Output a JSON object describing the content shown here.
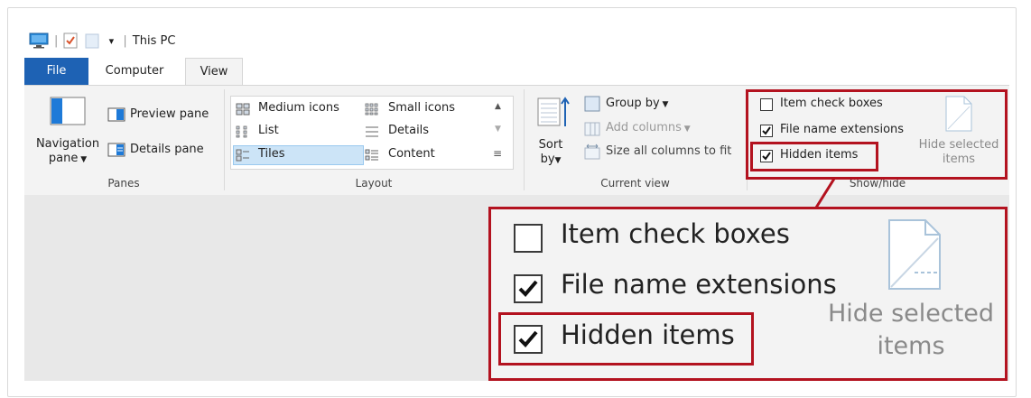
{
  "window": {
    "title": "This PC"
  },
  "tabs": {
    "file": "File",
    "computer": "Computer",
    "view": "View"
  },
  "panes": {
    "group_label": "Panes",
    "navigation_pane_line1": "Navigation",
    "navigation_pane_line2": "pane",
    "preview_pane": "Preview pane",
    "details_pane": "Details pane"
  },
  "layout": {
    "group_label": "Layout",
    "items": [
      "Medium icons",
      "Small icons",
      "List",
      "Details",
      "Tiles",
      "Content"
    ],
    "selected": "Tiles"
  },
  "current_view": {
    "group_label": "Current view",
    "sort_line1": "Sort",
    "sort_line2": "by",
    "group_by": "Group by",
    "add_columns": "Add columns",
    "size_all_columns": "Size all columns to fit"
  },
  "show_hide": {
    "group_label": "Show/hide",
    "item_check_boxes": "Item check boxes",
    "file_name_extensions": "File name extensions",
    "hidden_items": "Hidden items",
    "hide_selected_line1": "Hide selected",
    "hide_selected_line2": "items",
    "checked": {
      "item_check_boxes": false,
      "file_name_extensions": true,
      "hidden_items": true
    }
  },
  "colors": {
    "file_tab": "#1e62b4",
    "highlight": "#b3121f",
    "selected": "#cce4f7"
  },
  "icons": [
    "computer-icon",
    "properties-icon",
    "new-folder-icon",
    "customize-qat-icon",
    "navigation-pane-icon",
    "preview-pane-icon",
    "details-pane-icon",
    "sort-icon",
    "group-by-icon",
    "add-columns-icon",
    "size-columns-icon",
    "hide-selected-icon"
  ]
}
